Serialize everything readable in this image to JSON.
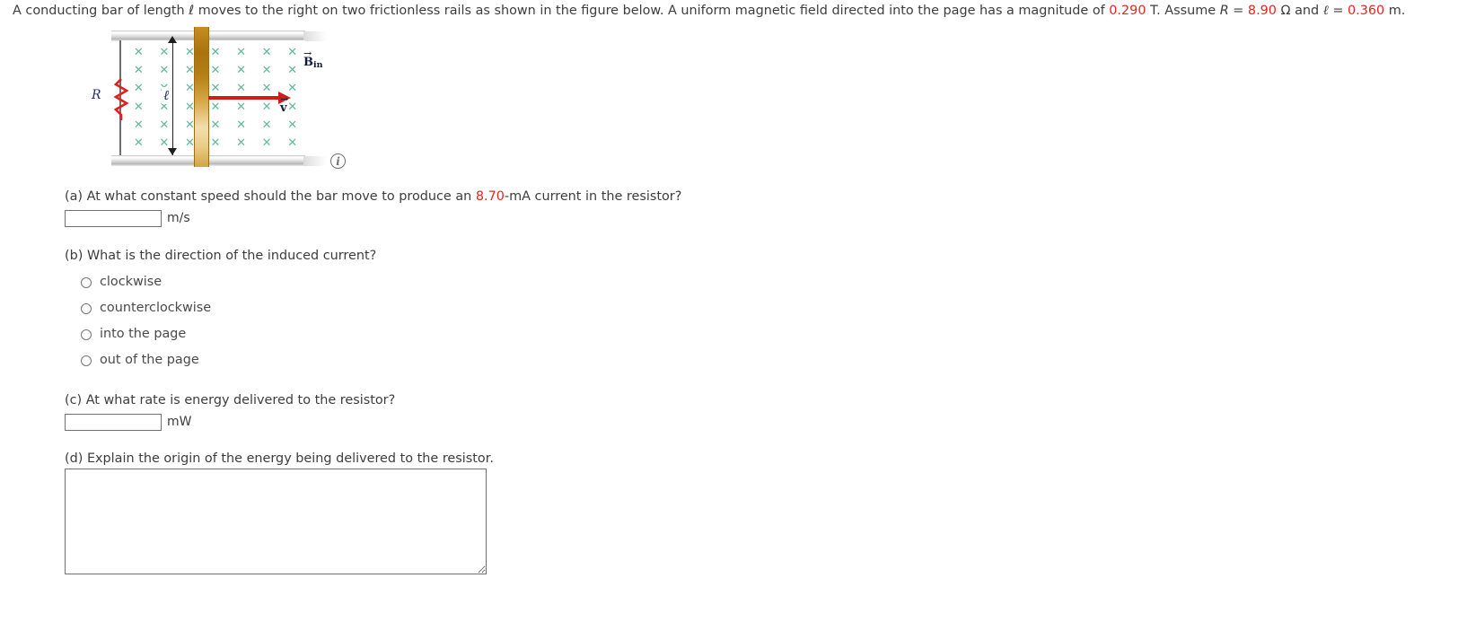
{
  "problem": {
    "text_before_b": "A conducting bar of length ℓ moves to the right on two frictionless rails as shown in the figure below. A uniform magnetic field directed into the page has a magnitude of ",
    "b_value": "0.290",
    "text_after_b": " T. Assume ",
    "r_symbol": "R",
    "r_equals": " = ",
    "r_value": "8.90",
    "r_unit": " Ω and ",
    "l_symbol": "ℓ",
    "l_equals": " = ",
    "l_value": "0.360",
    "l_unit": " m."
  },
  "figure": {
    "resistor_label": "R",
    "length_label": "ℓ",
    "field_label_b": "B",
    "field_label_sub": "in",
    "velocity_label": "v",
    "field_mark": "✕",
    "info_icon_glyph": "i",
    "mark_color": "#64b89a",
    "arrow_color": "#d21b17",
    "bar_color": "#c58f22"
  },
  "parts": {
    "a": {
      "question_prefix": "(a) At what constant speed should the bar move to produce an ",
      "highlight": "8.70",
      "question_suffix": "-mA current in the resistor?",
      "input_value": "",
      "unit": "m/s"
    },
    "b": {
      "question": "(b) What is the direction of the induced current?",
      "options": [
        {
          "label": "clockwise",
          "selected": false
        },
        {
          "label": "counterclockwise",
          "selected": false
        },
        {
          "label": "into the page",
          "selected": false
        },
        {
          "label": "out of the page",
          "selected": false
        }
      ]
    },
    "c": {
      "question": "(c) At what rate is energy delivered to the resistor?",
      "input_value": "",
      "unit": "mW"
    },
    "d": {
      "question": "(d) Explain the origin of the energy being delivered to the resistor.",
      "textarea_value": ""
    }
  }
}
